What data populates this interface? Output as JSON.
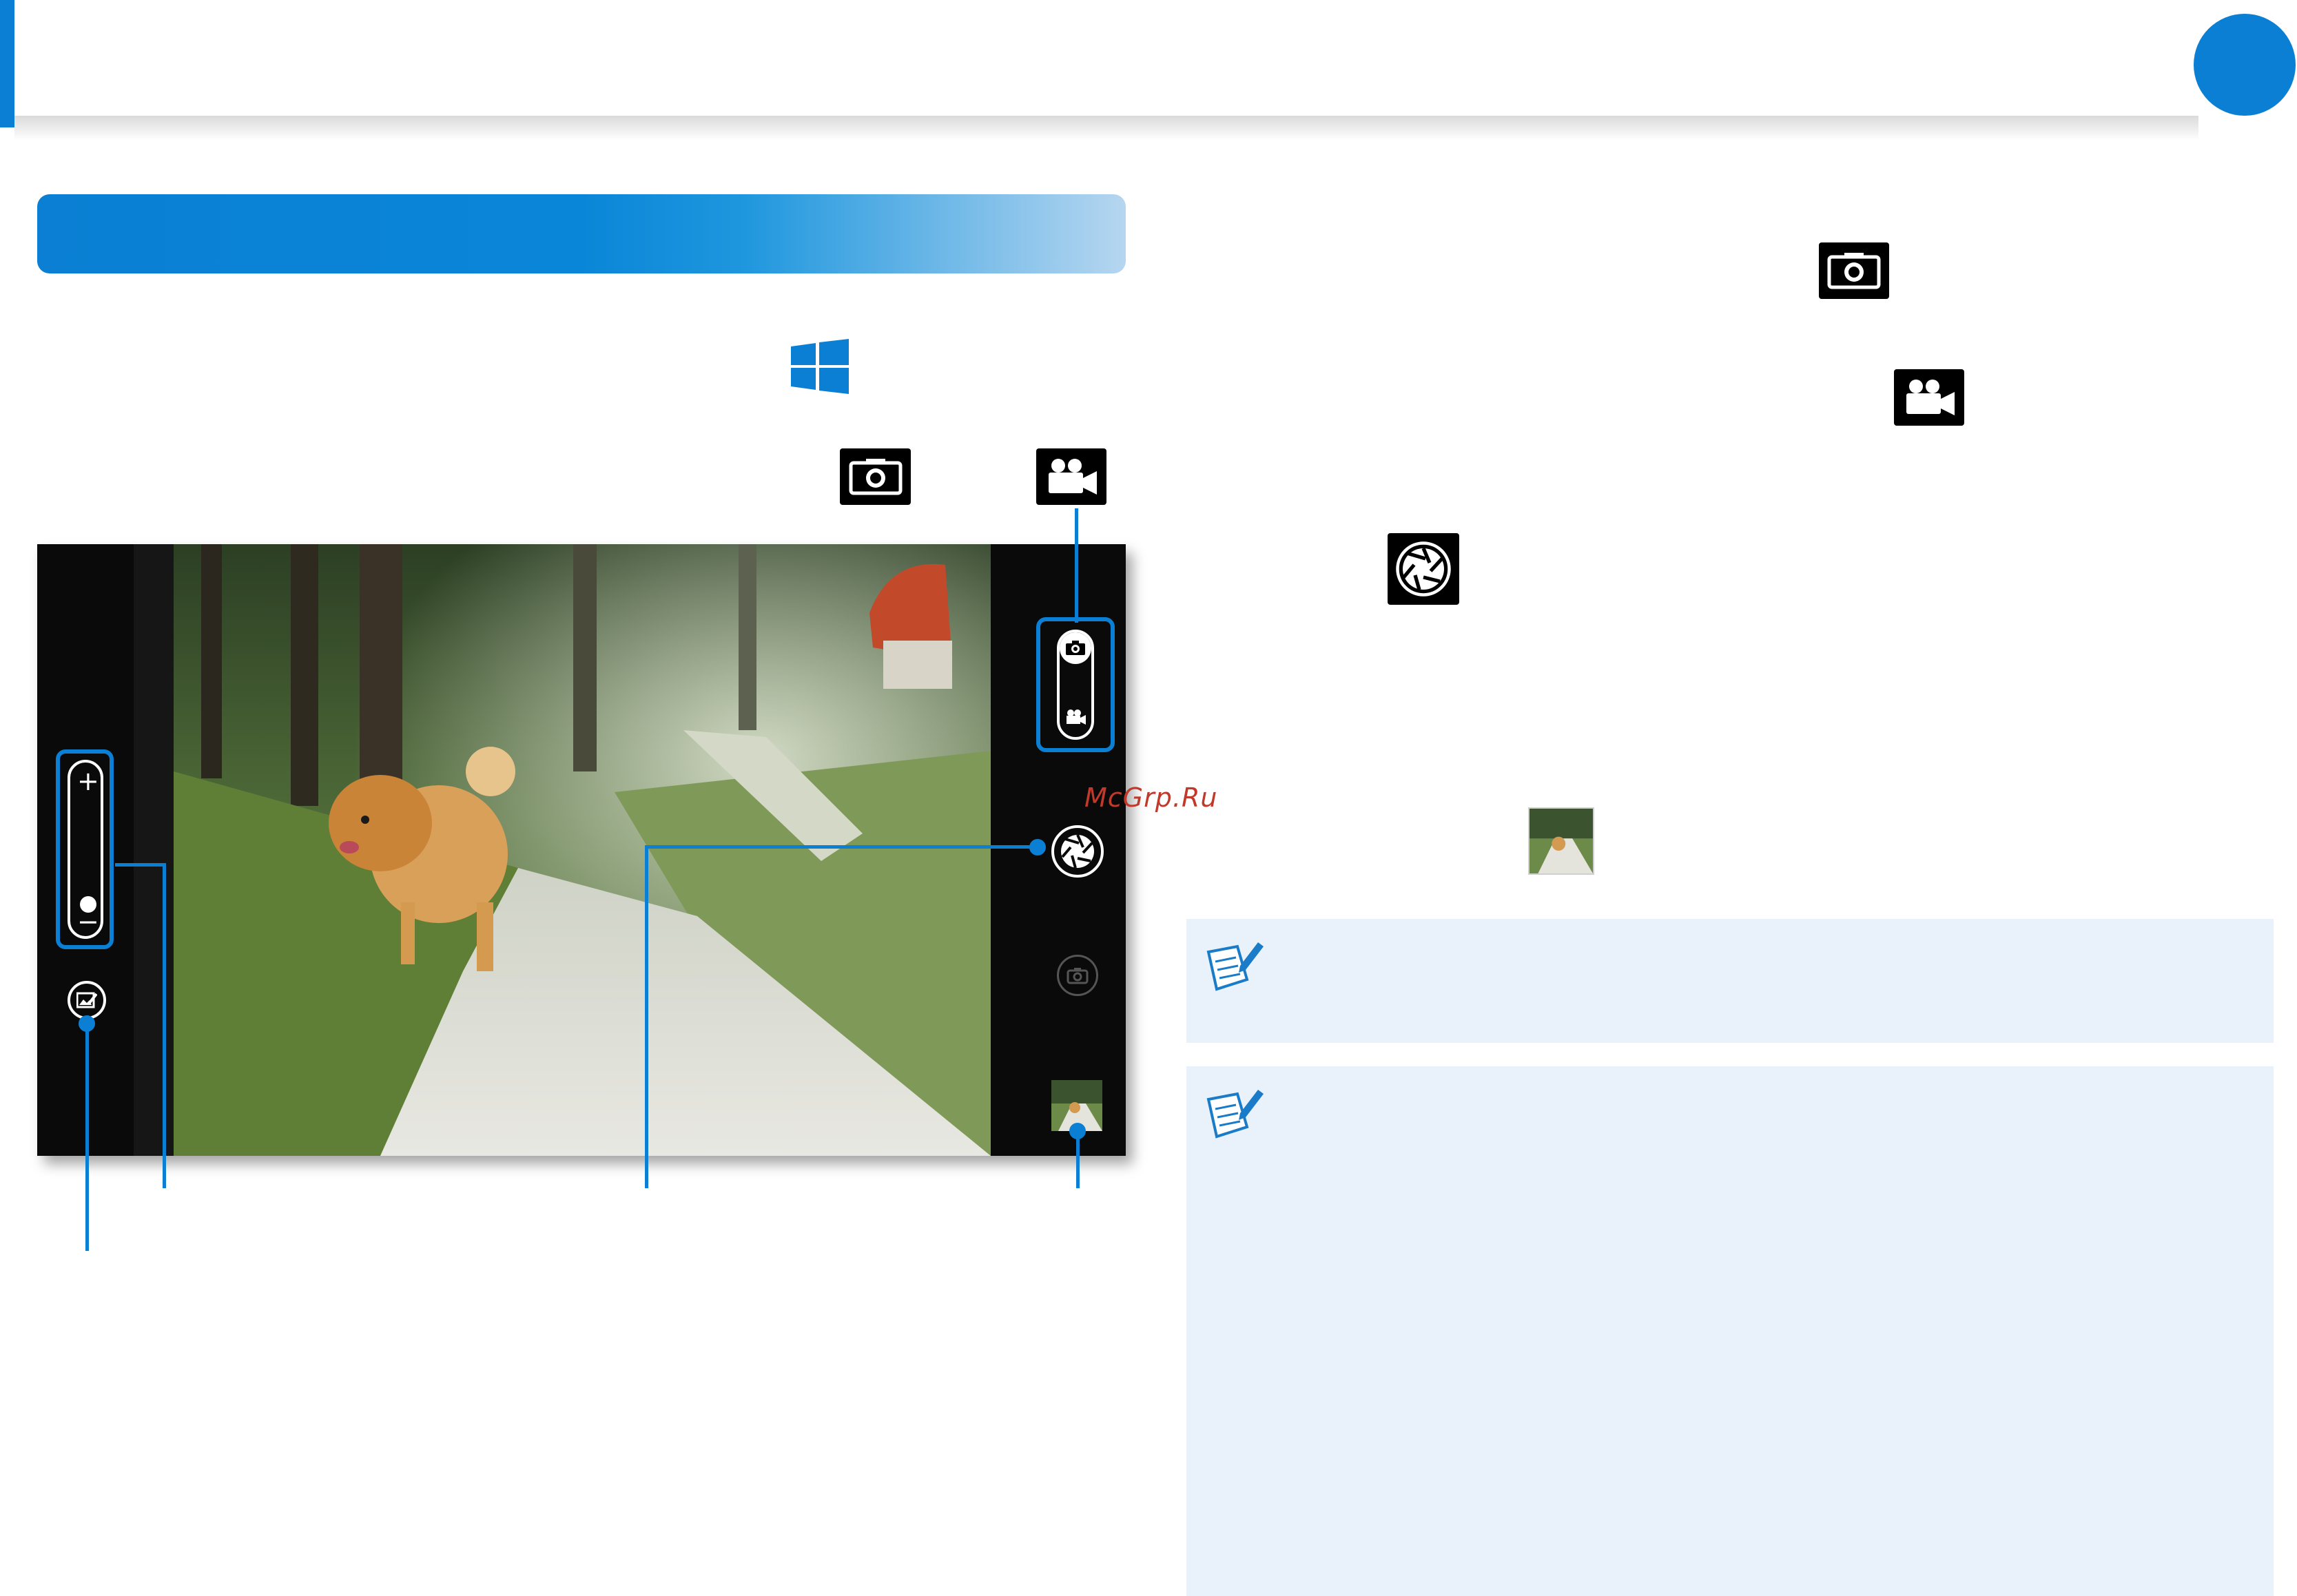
{
  "header": {
    "accent_color": "#0a7fd3",
    "page_indicator_color": "#0a7fd3"
  },
  "section_banner": {
    "gradient_start": "#0a7fd3",
    "gradient_end": "#b6d6f0"
  },
  "icons": {
    "start": "windows-logo-icon",
    "photo_mode": "camera-icon",
    "video_mode": "video-camera-icon",
    "shutter": "shutter-icon",
    "gallery": "thumbnail-image",
    "note": "note-pencil-icon"
  },
  "camera_app": {
    "zoom": {
      "plus_label": "+",
      "minus_label": "−"
    },
    "mode_toggle": [
      "photo",
      "video"
    ],
    "controls": [
      "shutter-button",
      "camera-switch-button",
      "gallery-thumbnail",
      "edit-button"
    ]
  },
  "notes_background": "#e9f2fb",
  "watermark": "McGrp.Ru"
}
